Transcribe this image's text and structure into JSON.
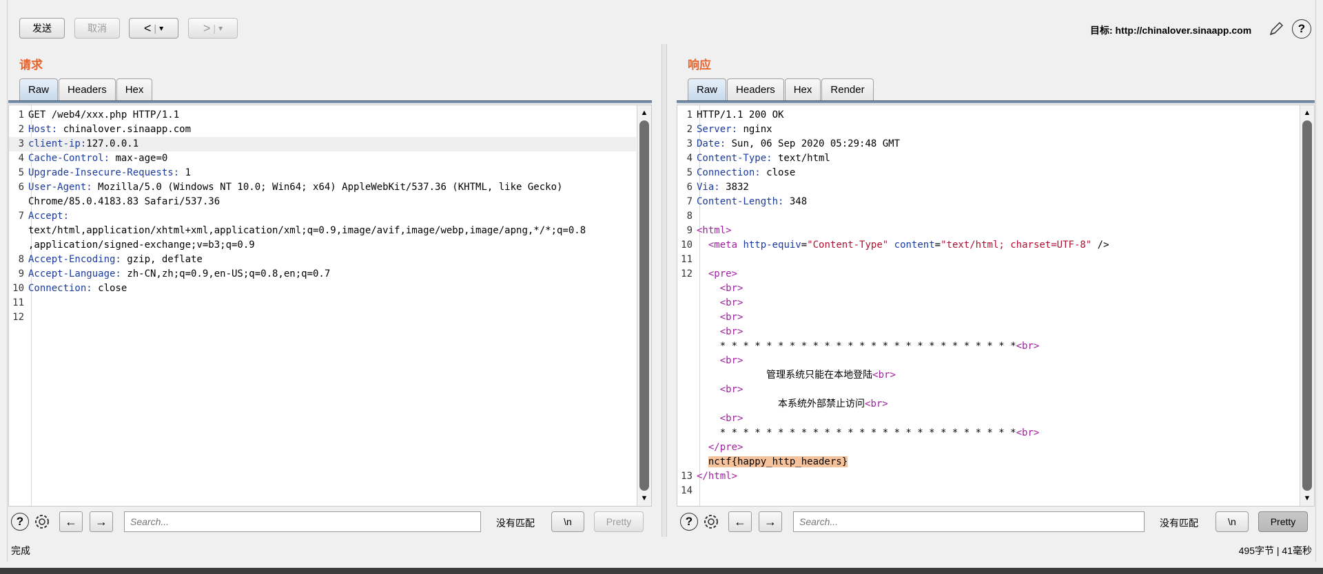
{
  "toolbar": {
    "send_label": "发送",
    "cancel_label": "取消",
    "back_label": "<",
    "forward_label": ">",
    "dropdown_glyph": "▾",
    "target_label": "目标: http://chinalover.sinaapp.com"
  },
  "request": {
    "title": "请求",
    "tabs": [
      "Raw",
      "Headers",
      "Hex"
    ],
    "active_tab": "Raw",
    "line_numbers": [
      "1",
      "2",
      "3",
      "",
      "4",
      "5",
      "6",
      "",
      "7",
      "",
      "",
      "8",
      "9",
      "10",
      "11",
      "12"
    ],
    "search_placeholder": "Search...",
    "no_match": "没有匹配",
    "newline_label": "\\n",
    "pretty_label": "Pretty"
  },
  "response": {
    "title": "响应",
    "tabs": [
      "Raw",
      "Headers",
      "Hex",
      "Render"
    ],
    "active_tab": "Raw",
    "search_placeholder": "Search...",
    "no_match": "没有匹配",
    "newline_label": "\\n",
    "pretty_label": "Pretty",
    "flag": "nctf{happy_http_headers}"
  },
  "request_lines": [
    {
      "n": "1",
      "parts": [
        [
          "t",
          "GET /web4/xxx.php HTTP/1.1"
        ]
      ]
    },
    {
      "n": "2",
      "parts": [
        [
          "k",
          "Host:"
        ],
        [
          "t",
          " chinalover.sinaapp.com"
        ]
      ]
    },
    {
      "n": "3",
      "hl": true,
      "parts": [
        [
          "k",
          "client-ip:"
        ],
        [
          "t",
          "127.0.0.1"
        ]
      ]
    },
    {
      "n": "4",
      "parts": [
        [
          "k",
          "Cache-Control:"
        ],
        [
          "t",
          " max-age=0"
        ]
      ]
    },
    {
      "n": "5",
      "parts": [
        [
          "k",
          "Upgrade-Insecure-Requests:"
        ],
        [
          "t",
          " 1"
        ]
      ]
    },
    {
      "n": "6",
      "parts": [
        [
          "k",
          "User-Agent:"
        ],
        [
          "t",
          " Mozilla/5.0 (Windows NT 10.0; Win64; x64) AppleWebKit/537.36 (KHTML, like Gecko)"
        ]
      ]
    },
    {
      "n": "",
      "parts": [
        [
          "t",
          "Chrome/85.0.4183.83 Safari/537.36"
        ]
      ]
    },
    {
      "n": "7",
      "parts": [
        [
          "k",
          "Accept:"
        ]
      ]
    },
    {
      "n": "",
      "parts": [
        [
          "t",
          "text/html,application/xhtml+xml,application/xml;q=0.9,image/avif,image/webp,image/apng,*/*;q=0.8"
        ]
      ]
    },
    {
      "n": "",
      "parts": [
        [
          "t",
          ",application/signed-exchange;v=b3;q=0.9"
        ]
      ]
    },
    {
      "n": "8",
      "parts": [
        [
          "k",
          "Accept-Encoding:"
        ],
        [
          "t",
          " gzip, deflate"
        ]
      ]
    },
    {
      "n": "9",
      "parts": [
        [
          "k",
          "Accept-Language:"
        ],
        [
          "t",
          " zh-CN,zh;q=0.9,en-US;q=0.8,en;q=0.7"
        ]
      ]
    },
    {
      "n": "10",
      "parts": [
        [
          "k",
          "Connection:"
        ],
        [
          "t",
          " close"
        ]
      ]
    },
    {
      "n": "11",
      "parts": []
    },
    {
      "n": "12",
      "parts": []
    }
  ],
  "response_lines": [
    {
      "n": "1",
      "parts": [
        [
          "t",
          "HTTP/1.1 200 OK"
        ]
      ]
    },
    {
      "n": "2",
      "parts": [
        [
          "k",
          "Server:"
        ],
        [
          "t",
          " nginx"
        ]
      ]
    },
    {
      "n": "3",
      "parts": [
        [
          "k",
          "Date:"
        ],
        [
          "t",
          " Sun, 06 Sep 2020 05:29:48 GMT"
        ]
      ]
    },
    {
      "n": "4",
      "parts": [
        [
          "k",
          "Content-Type:"
        ],
        [
          "t",
          " text/html"
        ]
      ]
    },
    {
      "n": "5",
      "parts": [
        [
          "k",
          "Connection:"
        ],
        [
          "t",
          " close"
        ]
      ]
    },
    {
      "n": "6",
      "parts": [
        [
          "k",
          "Via:"
        ],
        [
          "t",
          " 3832"
        ]
      ]
    },
    {
      "n": "7",
      "parts": [
        [
          "k",
          "Content-Length:"
        ],
        [
          "t",
          " 348"
        ]
      ]
    },
    {
      "n": "8",
      "parts": []
    },
    {
      "n": "9",
      "parts": [
        [
          "g",
          "<html>"
        ]
      ]
    },
    {
      "n": "10",
      "parts": [
        [
          "t",
          "  "
        ],
        [
          "g",
          "<meta"
        ],
        [
          "t",
          " "
        ],
        [
          "a",
          "http-equiv"
        ],
        [
          "t",
          "="
        ],
        [
          "s",
          "\"Content-Type\""
        ],
        [
          "t",
          " "
        ],
        [
          "a",
          "content"
        ],
        [
          "t",
          "="
        ],
        [
          "s",
          "\"text/html; charset=UTF-8\""
        ],
        [
          "t",
          " />"
        ]
      ]
    },
    {
      "n": "11",
      "parts": []
    },
    {
      "n": "12",
      "parts": [
        [
          "t",
          "  "
        ],
        [
          "g",
          "<pre>"
        ]
      ]
    },
    {
      "n": "",
      "parts": [
        [
          "t",
          "    "
        ],
        [
          "g",
          "<br>"
        ]
      ]
    },
    {
      "n": "",
      "parts": [
        [
          "t",
          "    "
        ],
        [
          "g",
          "<br>"
        ]
      ]
    },
    {
      "n": "",
      "parts": [
        [
          "t",
          "    "
        ],
        [
          "g",
          "<br>"
        ]
      ]
    },
    {
      "n": "",
      "parts": [
        [
          "t",
          "    "
        ],
        [
          "g",
          "<br>"
        ]
      ]
    },
    {
      "n": "",
      "parts": [
        [
          "t",
          "    * * * * * * * * * * * * * * * * * * * * * * * * * *"
        ],
        [
          "g",
          "<br>"
        ]
      ]
    },
    {
      "n": "",
      "parts": [
        [
          "t",
          "    "
        ],
        [
          "g",
          "<br>"
        ]
      ]
    },
    {
      "n": "",
      "parts": [
        [
          "t",
          "            管理系统只能在本地登陆"
        ],
        [
          "g",
          "<br>"
        ]
      ]
    },
    {
      "n": "",
      "parts": [
        [
          "t",
          "    "
        ],
        [
          "g",
          "<br>"
        ]
      ]
    },
    {
      "n": "",
      "parts": [
        [
          "t",
          "              本系统外部禁止访问"
        ],
        [
          "g",
          "<br>"
        ]
      ]
    },
    {
      "n": "",
      "parts": [
        [
          "t",
          "    "
        ],
        [
          "g",
          "<br>"
        ]
      ]
    },
    {
      "n": "",
      "parts": [
        [
          "t",
          "    * * * * * * * * * * * * * * * * * * * * * * * * * *"
        ],
        [
          "g",
          "<br>"
        ]
      ]
    },
    {
      "n": "",
      "parts": [
        [
          "t",
          "  "
        ],
        [
          "g",
          "</pre>"
        ]
      ]
    },
    {
      "n": "",
      "parts": [
        [
          "t",
          "  "
        ],
        [
          "f",
          "nctf{happy_http_headers}"
        ]
      ]
    },
    {
      "n": "13",
      "parts": [
        [
          "g",
          "</html>"
        ]
      ]
    },
    {
      "n": "14",
      "parts": []
    }
  ],
  "status": {
    "left": "完成",
    "right": "495字节 | 41毫秒"
  },
  "icons": {
    "edit": "pencil-icon",
    "help": "help-icon",
    "settings": "gear-icon",
    "prev": "arrow-left-icon",
    "next": "arrow-right-icon",
    "scroll_up": "scroll-up-arrow-icon",
    "scroll_down": "scroll-down-arrow-icon"
  },
  "colors": {
    "title_orange": "#e8642c",
    "header_key_blue": "#1a3a9e",
    "tag_purple": "#a020a0",
    "string_red": "#b01030",
    "flag_highlight": "#f6c29b"
  }
}
